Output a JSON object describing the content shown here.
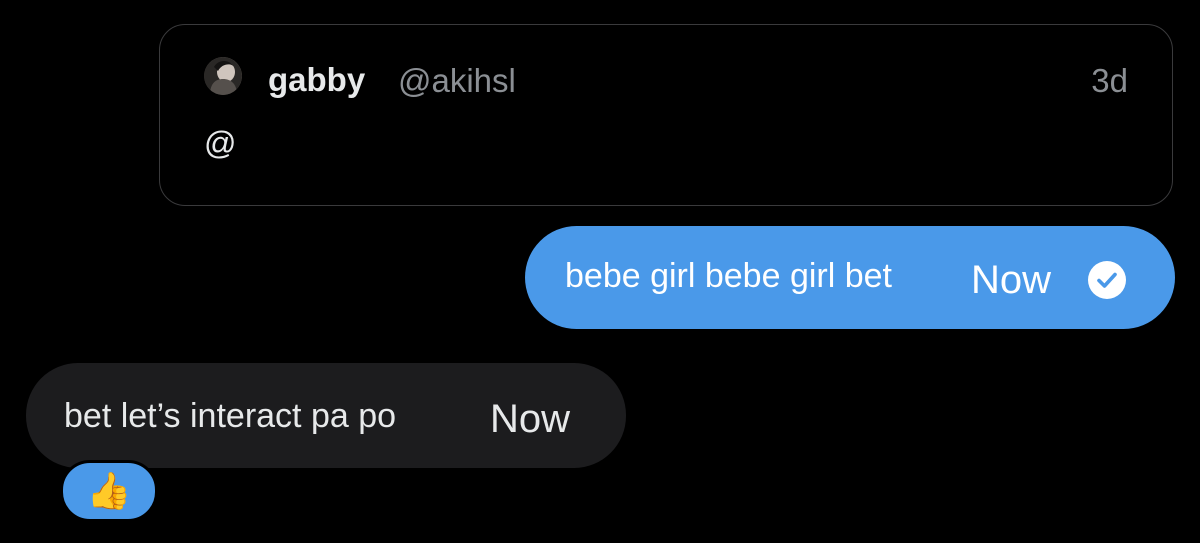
{
  "quoted_post": {
    "author_name": "gabby",
    "author_handle": "@akihsl",
    "time": "3d",
    "body": "@"
  },
  "messages": [
    {
      "direction": "sent",
      "text": "bebe girl bebe girl bet",
      "time": "Now",
      "status_icon": "check-circle-icon",
      "bubble_color": "#4a99e9"
    },
    {
      "direction": "received",
      "text": "bet let’s interact pa po",
      "time": "Now",
      "bubble_color": "#1c1c1e",
      "reaction": "👍"
    }
  ],
  "colors": {
    "background": "#000000",
    "accent": "#4a99e9",
    "secondary_text": "#8b8f94"
  }
}
